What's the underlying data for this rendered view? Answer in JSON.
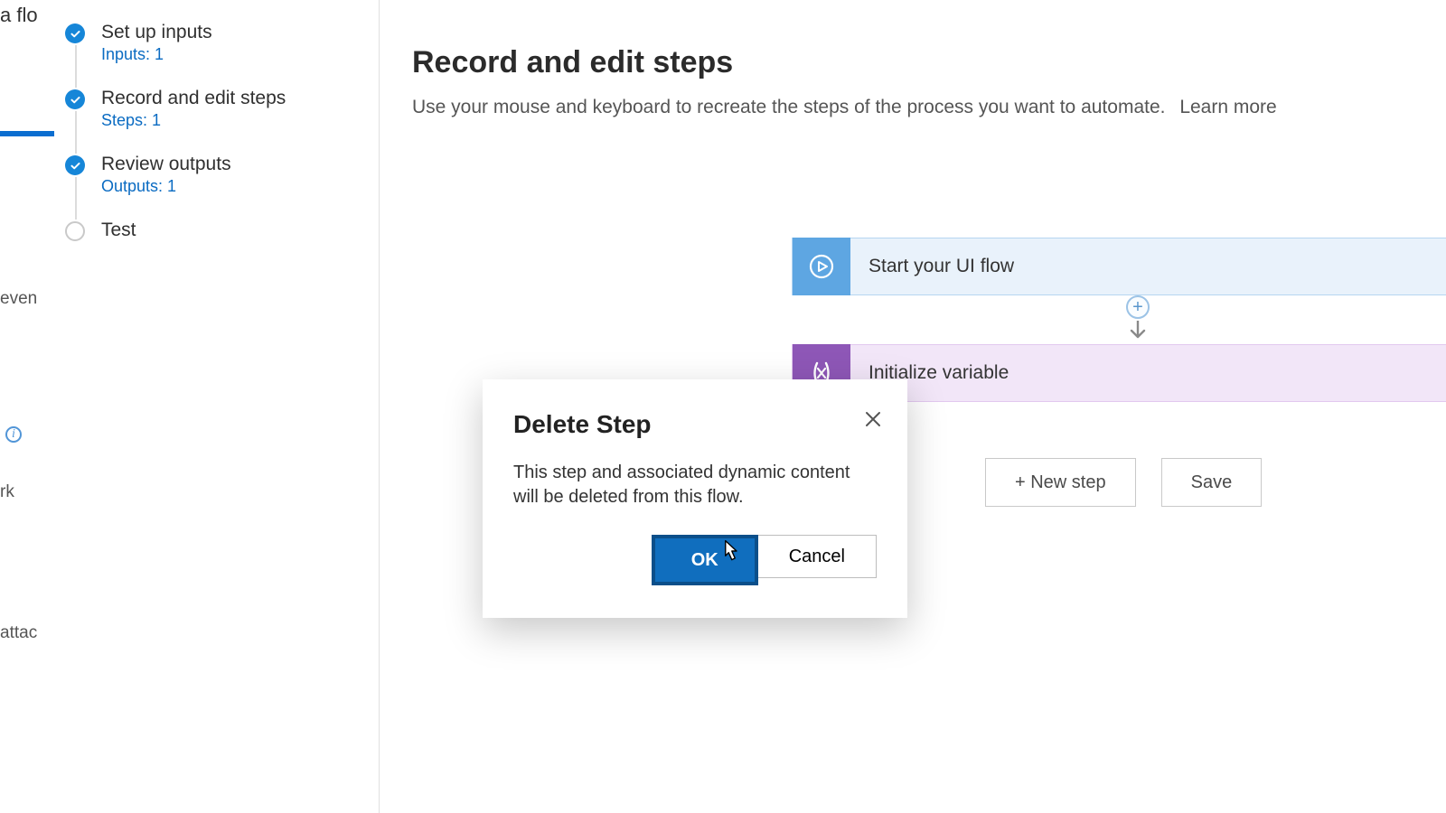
{
  "rail": {
    "frag_top": "a flo",
    "frag_even": "even",
    "frag_rk": "rk",
    "frag_attac": "attac"
  },
  "sidebar": {
    "items": [
      {
        "title": "Set up inputs",
        "sub": "Inputs: 1",
        "done": true
      },
      {
        "title": "Record and edit steps",
        "sub": "Steps: 1",
        "done": true
      },
      {
        "title": "Review outputs",
        "sub": "Outputs: 1",
        "done": true
      },
      {
        "title": "Test",
        "sub": "",
        "done": false
      }
    ]
  },
  "main": {
    "title": "Record and edit steps",
    "desc": "Use your mouse and keyboard to recreate the steps of the process you want to automate.",
    "learn_more": "Learn more",
    "card_start": "Start your UI flow",
    "card_var": "Initialize variable",
    "new_step": "+ New step",
    "save": "Save"
  },
  "dialog": {
    "title": "Delete Step",
    "body": "This step and associated dynamic content will be deleted from this flow.",
    "ok": "OK",
    "cancel": "Cancel"
  }
}
